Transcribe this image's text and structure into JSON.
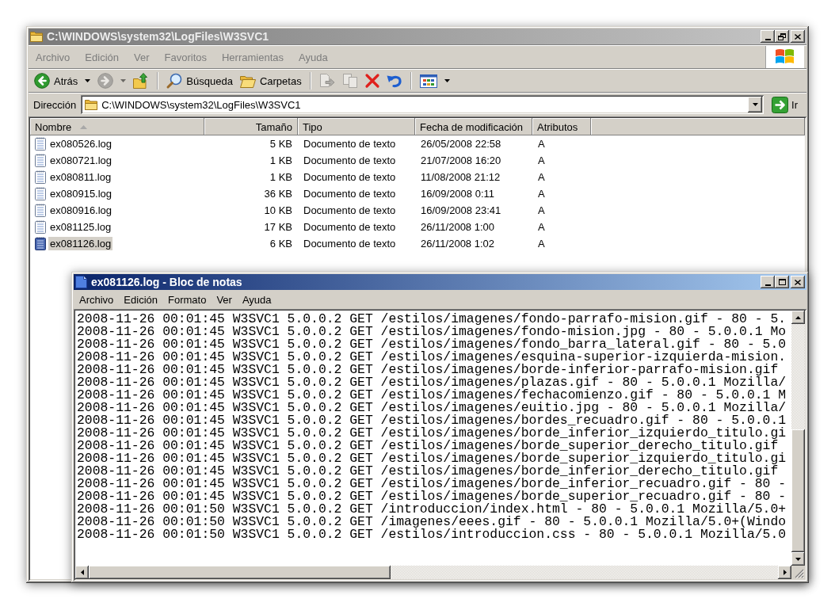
{
  "explorer": {
    "title": "C:\\WINDOWS\\system32\\LogFiles\\W3SVC1",
    "active": false,
    "maximized": true,
    "menu": [
      "Archivo",
      "Edición",
      "Ver",
      "Favoritos",
      "Herramientas",
      "Ayuda"
    ],
    "toolbar": [
      {
        "kind": "back",
        "label": "Atrás",
        "disabled": false,
        "dropdown": true
      },
      {
        "kind": "forward",
        "disabled": true,
        "dropdown": true
      },
      {
        "kind": "up",
        "disabled": false,
        "dropdown": false
      },
      {
        "kind": "separator"
      },
      {
        "kind": "search",
        "label": "Búsqueda",
        "disabled": false,
        "dropdown": false
      },
      {
        "kind": "folders",
        "label": "Carpetas",
        "disabled": false,
        "dropdown": false
      },
      {
        "kind": "separator"
      },
      {
        "kind": "move",
        "disabled": true,
        "dropdown": false
      },
      {
        "kind": "copy",
        "disabled": true,
        "dropdown": false
      },
      {
        "kind": "delete",
        "disabled": false,
        "dropdown": false
      },
      {
        "kind": "undo",
        "disabled": false,
        "dropdown": false
      },
      {
        "kind": "separator"
      },
      {
        "kind": "views",
        "disabled": false,
        "dropdown": true
      }
    ],
    "address": {
      "label": "Dirección",
      "value": "C:\\WINDOWS\\system32\\LogFiles\\W3SVC1",
      "go_label": "Ir"
    },
    "table": {
      "columns": [
        {
          "label": "Nombre",
          "sorted": true
        },
        {
          "label": "Tamaño",
          "sorted": false
        },
        {
          "label": "Tipo",
          "sorted": false
        },
        {
          "label": "Fecha de modificación",
          "sorted": false
        },
        {
          "label": "Atributos",
          "sorted": false
        }
      ],
      "rows": [
        {
          "cells": [
            "ex080526.log",
            "5 KB",
            "Documento de texto",
            "26/05/2008 22:58",
            "A"
          ],
          "selected": false
        },
        {
          "cells": [
            "ex080721.log",
            "1 KB",
            "Documento de texto",
            "21/07/2008 16:20",
            "A"
          ],
          "selected": false
        },
        {
          "cells": [
            "ex080811.log",
            "1 KB",
            "Documento de texto",
            "11/08/2008 21:12",
            "A"
          ],
          "selected": false
        },
        {
          "cells": [
            "ex080915.log",
            "36 KB",
            "Documento de texto",
            "16/09/2008 0:11",
            "A"
          ],
          "selected": false
        },
        {
          "cells": [
            "ex080916.log",
            "10 KB",
            "Documento de texto",
            "16/09/2008 23:41",
            "A"
          ],
          "selected": false
        },
        {
          "cells": [
            "ex081125.log",
            "17 KB",
            "Documento de texto",
            "26/11/2008 1:00",
            "A"
          ],
          "selected": false
        },
        {
          "cells": [
            "ex081126.log",
            "6 KB",
            "Documento de texto",
            "26/11/2008 1:02",
            "A"
          ],
          "selected": true
        }
      ]
    }
  },
  "notepad": {
    "title": "ex081126.log - Bloc de notas",
    "active": true,
    "maximized": false,
    "menu": [
      "Archivo",
      "Edición",
      "Formato",
      "Ver",
      "Ayuda"
    ],
    "lines": [
      "2008-11-26 00:01:45 W3SVC1 5.0.0.2 GET /estilos/imagenes/fondo-parrafo-mision.gif - 80 - 5.",
      "2008-11-26 00:01:45 W3SVC1 5.0.0.2 GET /estilos/imagenes/fondo-mision.jpg - 80 - 5.0.0.1 Mo",
      "2008-11-26 00:01:45 W3SVC1 5.0.0.2 GET /estilos/imagenes/fondo_barra_lateral.gif - 80 - 5.0",
      "2008-11-26 00:01:45 W3SVC1 5.0.0.2 GET /estilos/imagenes/esquina-superior-izquierda-mision.",
      "2008-11-26 00:01:45 W3SVC1 5.0.0.2 GET /estilos/imagenes/borde-inferior-parrafo-mision.gif",
      "2008-11-26 00:01:45 W3SVC1 5.0.0.2 GET /estilos/imagenes/plazas.gif - 80 - 5.0.0.1 Mozilla/",
      "2008-11-26 00:01:45 W3SVC1 5.0.0.2 GET /estilos/imagenes/fechacomienzo.gif - 80 - 5.0.0.1 M",
      "2008-11-26 00:01:45 W3SVC1 5.0.0.2 GET /estilos/imagenes/euitio.jpg - 80 - 5.0.0.1 Mozilla/",
      "2008-11-26 00:01:45 W3SVC1 5.0.0.2 GET /estilos/imagenes/bordes_recuadro.gif - 80 - 5.0.0.1",
      "2008-11-26 00:01:45 W3SVC1 5.0.0.2 GET /estilos/imagenes/borde_inferior_izquierdo_titulo.gi",
      "2008-11-26 00:01:45 W3SVC1 5.0.0.2 GET /estilos/imagenes/borde_superior_derecho_titulo.gif",
      "2008-11-26 00:01:45 W3SVC1 5.0.0.2 GET /estilos/imagenes/borde_superior_izquierdo_titulo.gi",
      "2008-11-26 00:01:45 W3SVC1 5.0.0.2 GET /estilos/imagenes/borde_inferior_derecho_titulo.gif",
      "2008-11-26 00:01:45 W3SVC1 5.0.0.2 GET /estilos/imagenes/borde_inferior_recuadro.gif - 80 -",
      "2008-11-26 00:01:45 W3SVC1 5.0.0.2 GET /estilos/imagenes/borde_superior_recuadro.gif - 80 -",
      "2008-11-26 00:01:50 W3SVC1 5.0.0.2 GET /introduccion/index.html - 80 - 5.0.0.1 Mozilla/5.0+",
      "2008-11-26 00:01:50 W3SVC1 5.0.0.2 GET /imagenes/eees.gif - 80 - 5.0.0.1 Mozilla/5.0+(Windo",
      "2008-11-26 00:01:50 W3SVC1 5.0.0.2 GET /estilos/introduccion.css - 80 - 5.0.0.1 Mozilla/5.0"
    ]
  }
}
